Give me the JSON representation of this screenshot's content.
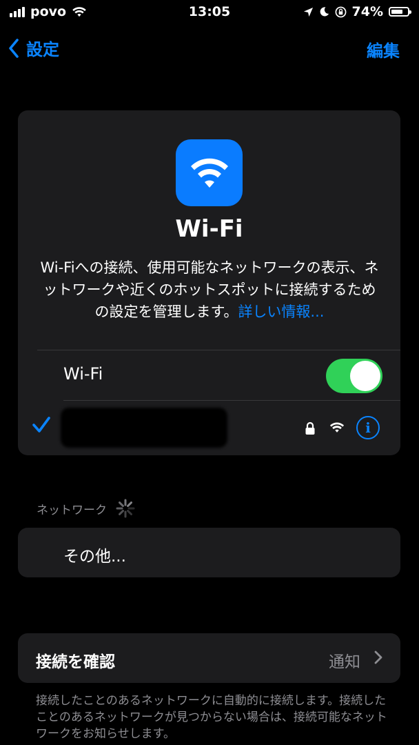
{
  "status_bar": {
    "carrier": "povo",
    "time": "13:05",
    "battery_percent": "74%",
    "battery_level": 0.74,
    "signal_bars": 4
  },
  "nav": {
    "back_label": "設定",
    "edit_label": "編集"
  },
  "header": {
    "title": "Wi-Fi",
    "description": "Wi-Fiへの接続、使用可能なネットワークの表示、ネットワークや近くのホットスポットに接続するための設定を管理します。",
    "link_label": "詳しい情報..."
  },
  "wifi_toggle": {
    "label": "Wi-Fi",
    "on": true
  },
  "connected_network": {
    "name_redacted": true,
    "secured": true
  },
  "networks_section": {
    "header": "ネットワーク",
    "other_label": "その他..."
  },
  "ask_to_join": {
    "label": "接続を確認",
    "value": "通知",
    "footer": "接続したことのあるネットワークに自動的に接続します。接続したことのあるネットワークが見つからない場合は、接続可能なネットワークをお知らせします。"
  },
  "colors": {
    "accent": "#0a84ff",
    "toggle_on": "#30d158",
    "card_bg": "#1c1c1e",
    "secondary_text": "#8e8e93"
  }
}
